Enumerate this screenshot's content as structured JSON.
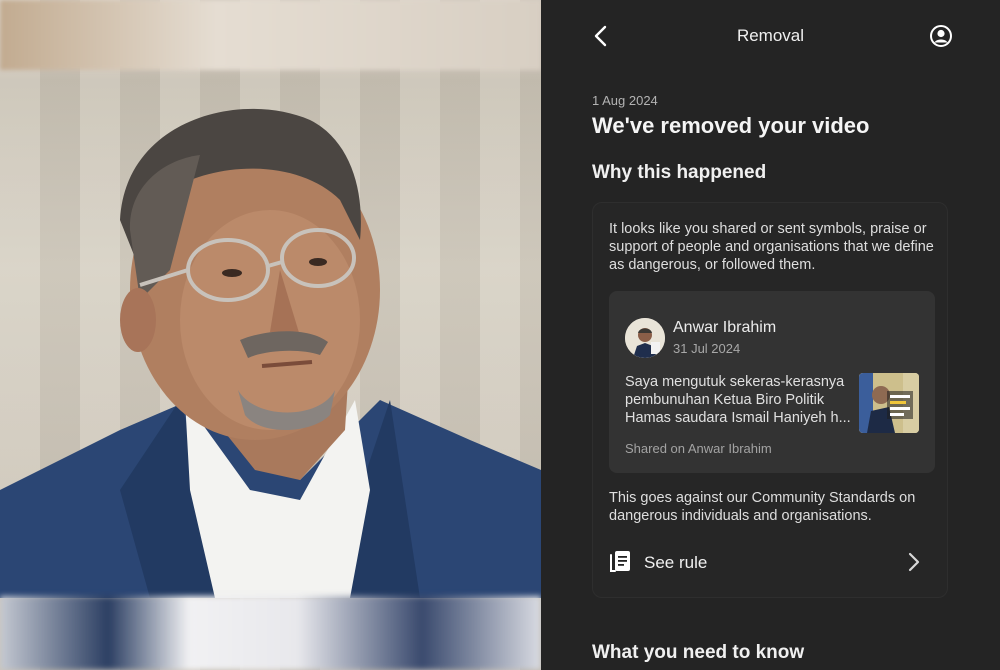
{
  "header": {
    "title": "Removal",
    "back_icon": "chevron-left-icon",
    "profile_icon": "user-circle-icon"
  },
  "notice": {
    "date": "1 Aug 2024",
    "headline": "We've removed your video"
  },
  "why": {
    "title": "Why this happened",
    "explanation": "It looks like you shared or sent symbols, praise or support of people and organisations that we define as dangerous, or followed them.",
    "post": {
      "author": "Anwar Ibrahim",
      "date": "31 Jul 2024",
      "text": "Saya mengutuk sekeras-kerasnya pembunuhan Ketua Biro Politik Hamas saudara Ismail Haniyeh h...",
      "shared_on": "Shared on Anwar Ibrahim"
    },
    "standards": "This goes against our Community Standards on dangerous individuals and organisations.",
    "see_rule_label": "See rule",
    "see_rule_icon": "rulebook-icon"
  },
  "next_section": {
    "title": "What you need to know"
  },
  "colors": {
    "panel_bg": "#242424",
    "card_bg": "#262626",
    "post_bg": "#333333",
    "text_primary": "#f0f0f0",
    "text_secondary": "#a8a8a8"
  }
}
